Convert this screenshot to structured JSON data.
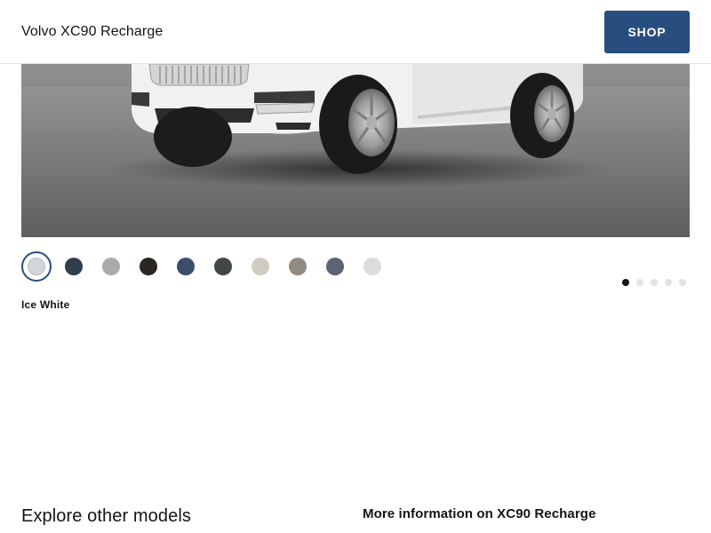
{
  "header": {
    "title": "Volvo XC90 Recharge",
    "shop_label": "SHOP",
    "shop_color": "#284e80"
  },
  "hero": {
    "image_alt_icon": "car-image"
  },
  "colors": {
    "selected_index": 0,
    "selected_name": "Ice White",
    "swatches": [
      {
        "hex": "#d3d6d8"
      },
      {
        "hex": "#2f3d4c"
      },
      {
        "hex": "#a9aaac"
      },
      {
        "hex": "#2a2522"
      },
      {
        "hex": "#3d4e6c"
      },
      {
        "hex": "#404842"
      },
      {
        "hex": "#cfcdc1"
      },
      {
        "hex": "#918a80"
      },
      {
        "hex": "#5c6470"
      },
      {
        "hex": "#dcdcdb"
      }
    ]
  },
  "carousel": {
    "page_count": 5,
    "active_page": 1
  },
  "footer": {
    "explore_label": "Explore other models",
    "more_info_label": "More information on XC90 Recharge"
  }
}
